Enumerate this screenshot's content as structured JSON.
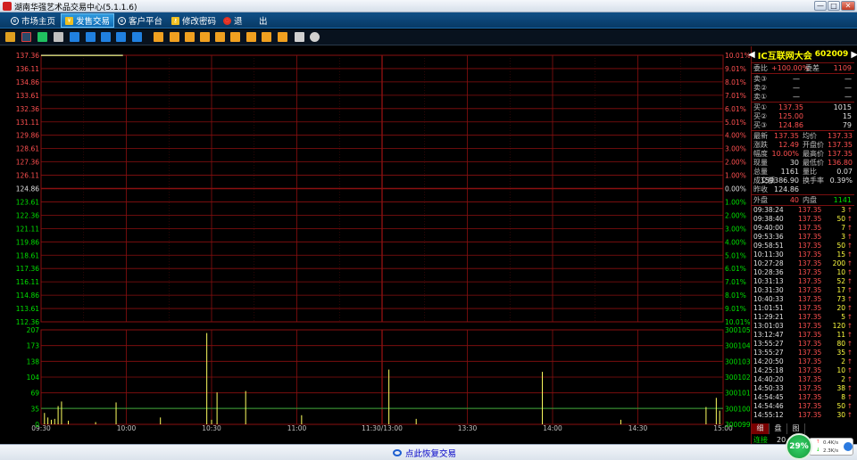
{
  "window": {
    "title": "湖南华强艺术品交易中心(5.1.1.6)",
    "min": "—",
    "max": "□",
    "close": "✕"
  },
  "menu": [
    {
      "label": "市场主页",
      "icon": "globe-icon"
    },
    {
      "label": "发售交易",
      "icon": "yen-icon",
      "active": true
    },
    {
      "label": "客户平台",
      "icon": "globe-icon"
    },
    {
      "label": "修改密码",
      "icon": "key-icon"
    },
    {
      "label": "退",
      "icon": "power-icon"
    },
    {
      "label": "出",
      "icon": ""
    }
  ],
  "colors": {
    "up": "#ff5050",
    "down": "#00e000",
    "grid": "#8a1010",
    "price_line": "#ffffff",
    "avg_line": "#ffff00",
    "volume_bar": "#ffff60"
  },
  "chart_data": [
    {
      "type": "line",
      "title": "",
      "ylim": [
        112.36,
        137.36
      ],
      "y_ticks_left": [
        "137.36",
        "136.11",
        "134.86",
        "133.61",
        "132.36",
        "131.11",
        "129.86",
        "128.61",
        "127.36",
        "126.11",
        "124.86",
        "123.61",
        "122.36",
        "121.11",
        "119.86",
        "118.61",
        "117.36",
        "116.11",
        "114.86",
        "113.61",
        "112.36"
      ],
      "y_ticks_right": [
        "10.01%",
        "9.01%",
        "8.01%",
        "7.01%",
        "6.01%",
        "5.01%",
        "4.00%",
        "3.00%",
        "2.00%",
        "1.00%",
        "0.00%",
        "1.00%",
        "2.00%",
        "3.00%",
        "4.00%",
        "5.01%",
        "6.01%",
        "7.01%",
        "8.01%",
        "9.01%",
        "10.01%"
      ],
      "base_price": 124.86,
      "x_ticks": [
        "09:30",
        "10:00",
        "10:30",
        "11:00",
        "11:30/13:00",
        "13:30",
        "14:00",
        "14:30",
        "15:00"
      ],
      "series": [
        {
          "x": [
            0,
            0.12
          ],
          "values": [
            137.35,
            137.35
          ]
        }
      ],
      "grid": true
    },
    {
      "type": "bar",
      "title": "",
      "ylim": [
        0,
        207
      ],
      "y_ticks_left": [
        "207",
        "173",
        "138",
        "104",
        "69",
        "35",
        "0"
      ],
      "y_ticks_right": [
        "300105",
        "300104",
        "300103",
        "300102",
        "300101",
        "300100",
        "300099"
      ],
      "avg_level": 35,
      "bars": [
        {
          "x": 0.005,
          "v": 25
        },
        {
          "x": 0.01,
          "v": 15
        },
        {
          "x": 0.015,
          "v": 10
        },
        {
          "x": 0.02,
          "v": 12
        },
        {
          "x": 0.025,
          "v": 40
        },
        {
          "x": 0.03,
          "v": 50
        },
        {
          "x": 0.04,
          "v": 8
        },
        {
          "x": 0.08,
          "v": 5
        },
        {
          "x": 0.11,
          "v": 48
        },
        {
          "x": 0.175,
          "v": 15
        },
        {
          "x": 0.243,
          "v": 200
        },
        {
          "x": 0.25,
          "v": 10
        },
        {
          "x": 0.258,
          "v": 70
        },
        {
          "x": 0.3,
          "v": 73
        },
        {
          "x": 0.382,
          "v": 20
        },
        {
          "x": 0.51,
          "v": 120
        },
        {
          "x": 0.55,
          "v": 12
        },
        {
          "x": 0.735,
          "v": 115
        },
        {
          "x": 0.85,
          "v": 10
        },
        {
          "x": 0.975,
          "v": 38
        },
        {
          "x": 0.99,
          "v": 58
        },
        {
          "x": 0.995,
          "v": 30
        }
      ],
      "grid": true
    }
  ],
  "quote": {
    "name": "IC互联网大会",
    "code": "602009",
    "wb_label": "委比",
    "wb_value": "+100.00%",
    "wc_label": "委差",
    "wc_value": "1109",
    "sells": [
      {
        "label": "卖③",
        "price": "—",
        "vol": "—"
      },
      {
        "label": "卖②",
        "price": "—",
        "vol": "—"
      },
      {
        "label": "卖①",
        "price": "—",
        "vol": "—"
      }
    ],
    "buys": [
      {
        "label": "买①",
        "price": "137.35",
        "vol": "1015"
      },
      {
        "label": "买②",
        "price": "125.00",
        "vol": "15"
      },
      {
        "label": "买③",
        "price": "124.86",
        "vol": "79"
      }
    ],
    "stats": [
      {
        "l1": "最新",
        "v1": "137.35",
        "c1": "red",
        "l2": "均价",
        "v2": "137.33",
        "c2": "red"
      },
      {
        "l1": "涨跌",
        "v1": "12.49",
        "c1": "red",
        "l2": "开盘价",
        "v2": "137.35",
        "c2": "red"
      },
      {
        "l1": "幅度",
        "v1": "10.00%",
        "c1": "red",
        "l2": "最高价",
        "v2": "137.35",
        "c2": "red"
      },
      {
        "l1": "现量",
        "v1": "30",
        "c1": "wht",
        "l2": "最低价",
        "v2": "136.80",
        "c2": "red"
      },
      {
        "l1": "总量",
        "v1": "1161",
        "c1": "wht",
        "l2": "量比",
        "v2": "0.07",
        "c2": "wht"
      },
      {
        "l1": "成交额",
        "v1": "159386.90",
        "c1": "wht",
        "l2": "换手率",
        "v2": "0.39%",
        "c2": "wht"
      },
      {
        "l1": "昨收",
        "v1": "124.86",
        "c1": "wht",
        "l2": "",
        "v2": "",
        "c2": "wht"
      }
    ],
    "outer_label": "外盘",
    "outer_value": "40",
    "inner_label": "内盘",
    "inner_value": "1141",
    "ticks": [
      {
        "t": "09:38:24",
        "p": "137.35",
        "v": "3"
      },
      {
        "t": "09:38:40",
        "p": "137.35",
        "v": "50"
      },
      {
        "t": "09:40:00",
        "p": "137.35",
        "v": "7"
      },
      {
        "t": "09:53:36",
        "p": "137.35",
        "v": "3"
      },
      {
        "t": "09:58:51",
        "p": "137.35",
        "v": "50"
      },
      {
        "t": "10:11:30",
        "p": "137.35",
        "v": "15"
      },
      {
        "t": "10:27:28",
        "p": "137.35",
        "v": "200"
      },
      {
        "t": "10:28:36",
        "p": "137.35",
        "v": "10"
      },
      {
        "t": "10:31:13",
        "p": "137.35",
        "v": "52"
      },
      {
        "t": "10:31:30",
        "p": "137.35",
        "v": "17"
      },
      {
        "t": "10:40:33",
        "p": "137.35",
        "v": "73"
      },
      {
        "t": "11:01:51",
        "p": "137.35",
        "v": "20"
      },
      {
        "t": "11:29:21",
        "p": "137.35",
        "v": "5"
      },
      {
        "t": "13:01:03",
        "p": "137.35",
        "v": "120"
      },
      {
        "t": "13:12:47",
        "p": "137.35",
        "v": "11"
      },
      {
        "t": "13:55:27",
        "p": "137.35",
        "v": "80"
      },
      {
        "t": "13:55:27",
        "p": "137.35",
        "v": "35"
      },
      {
        "t": "14:20:50",
        "p": "137.35",
        "v": "2"
      },
      {
        "t": "14:25:18",
        "p": "137.35",
        "v": "10"
      },
      {
        "t": "14:40:20",
        "p": "137.35",
        "v": "2"
      },
      {
        "t": "14:50:33",
        "p": "137.35",
        "v": "38"
      },
      {
        "t": "14:54:45",
        "p": "137.35",
        "v": "8"
      },
      {
        "t": "14:54:46",
        "p": "137.35",
        "v": "50"
      },
      {
        "t": "14:55:12",
        "p": "137.35",
        "v": "30"
      }
    ],
    "tabs": [
      "细",
      "盘",
      "图"
    ],
    "status_label": "连接",
    "status_value": "20"
  },
  "footer": {
    "restore_label": "点此恢复交易"
  },
  "net": {
    "percent": "29%",
    "up": "0.4K/s",
    "down": "2.3K/s"
  }
}
